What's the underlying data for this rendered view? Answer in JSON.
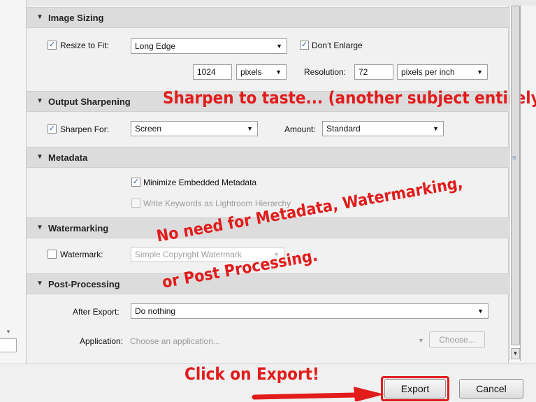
{
  "sections": {
    "image_sizing": "Image Sizing",
    "output_sharpening": "Output Sharpening",
    "metadata": "Metadata",
    "watermarking": "Watermarking",
    "post_processing": "Post-Processing"
  },
  "image_sizing": {
    "resize_label": "Resize to Fit:",
    "resize_value": "Long Edge",
    "dont_enlarge_label": "Don’t Enlarge",
    "size_value": "1024",
    "unit_value": "pixels",
    "resolution_label": "Resolution:",
    "resolution_value": "72",
    "resolution_unit": "pixels per inch"
  },
  "output_sharpening": {
    "sharpen_label": "Sharpen For:",
    "sharpen_value": "Screen",
    "amount_label": "Amount:",
    "amount_value": "Standard"
  },
  "metadata": {
    "minimize_label": "Minimize Embedded Metadata",
    "keywords_label": "Write Keywords as Lightroom Hierarchy"
  },
  "watermarking": {
    "watermark_label": "Watermark:",
    "watermark_value": "Simple Copyright Watermark"
  },
  "post_processing": {
    "after_export_label": "After Export:",
    "after_export_value": "Do nothing",
    "application_label": "Application:",
    "application_placeholder": "Choose an application...",
    "choose_label": "Choose..."
  },
  "buttons": {
    "export": "Export",
    "cancel": "Cancel"
  },
  "annotations": {
    "sharpen": "Sharpen to taste... (another subject entirely)",
    "no_need_line1": "No need for Metadata, Watermarking,",
    "no_need_line2": "or Post Processing.",
    "click_export": "Click on Export!"
  },
  "colors": {
    "annotation": "#e21b1b",
    "checkmark": "#2a55b0"
  }
}
